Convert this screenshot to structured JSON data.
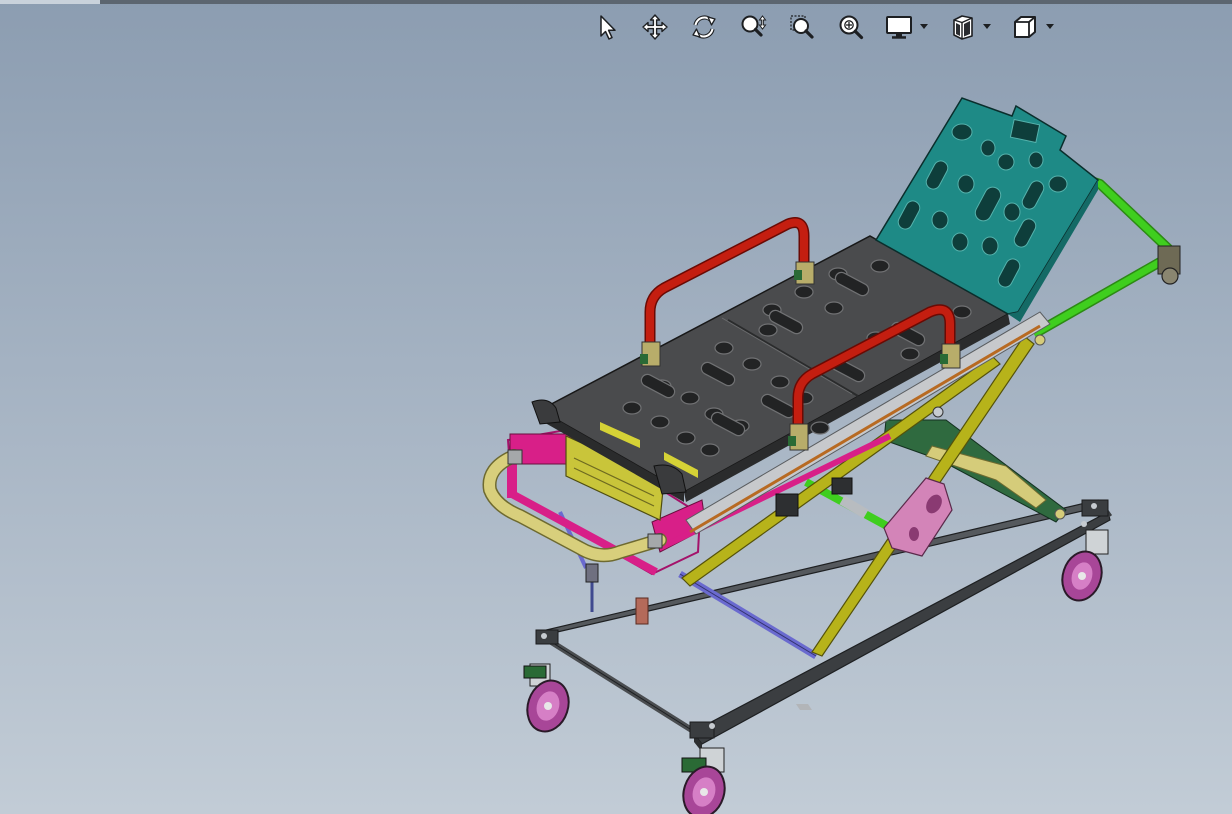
{
  "viewport": {
    "background_top": "#8c9db1",
    "background_bottom": "#c2ccd6"
  },
  "toolbar": {
    "buttons": [
      {
        "icon": "select-arrow-icon",
        "dropdown": false
      },
      {
        "icon": "pan-icon",
        "dropdown": false
      },
      {
        "icon": "rotate-view-icon",
        "dropdown": false
      },
      {
        "icon": "zoom-in-out-icon",
        "dropdown": false
      },
      {
        "icon": "zoom-to-area-icon",
        "dropdown": false
      },
      {
        "icon": "zoom-to-fit-icon",
        "dropdown": false
      },
      {
        "icon": "display-style-icon",
        "dropdown": true
      },
      {
        "icon": "view-settings-icon",
        "dropdown": true
      },
      {
        "icon": "view-orientation-icon",
        "dropdown": true
      }
    ]
  },
  "model": {
    "subject": "stretcher-trolley-assembly",
    "colors": {
      "tray": "#4a4a4a",
      "backrest": "#1e8a86",
      "handle": "#c41e10",
      "frame": "#3f4245",
      "scissor": "#b7b31a",
      "green_frame": "#3fce1e",
      "magenta_frame": "#d81f88",
      "pink_bracket": "#d384b8",
      "front_bar": "#d8cf7c",
      "wheel": "#b94fa5",
      "blue_rod": "#6a6acf"
    }
  }
}
